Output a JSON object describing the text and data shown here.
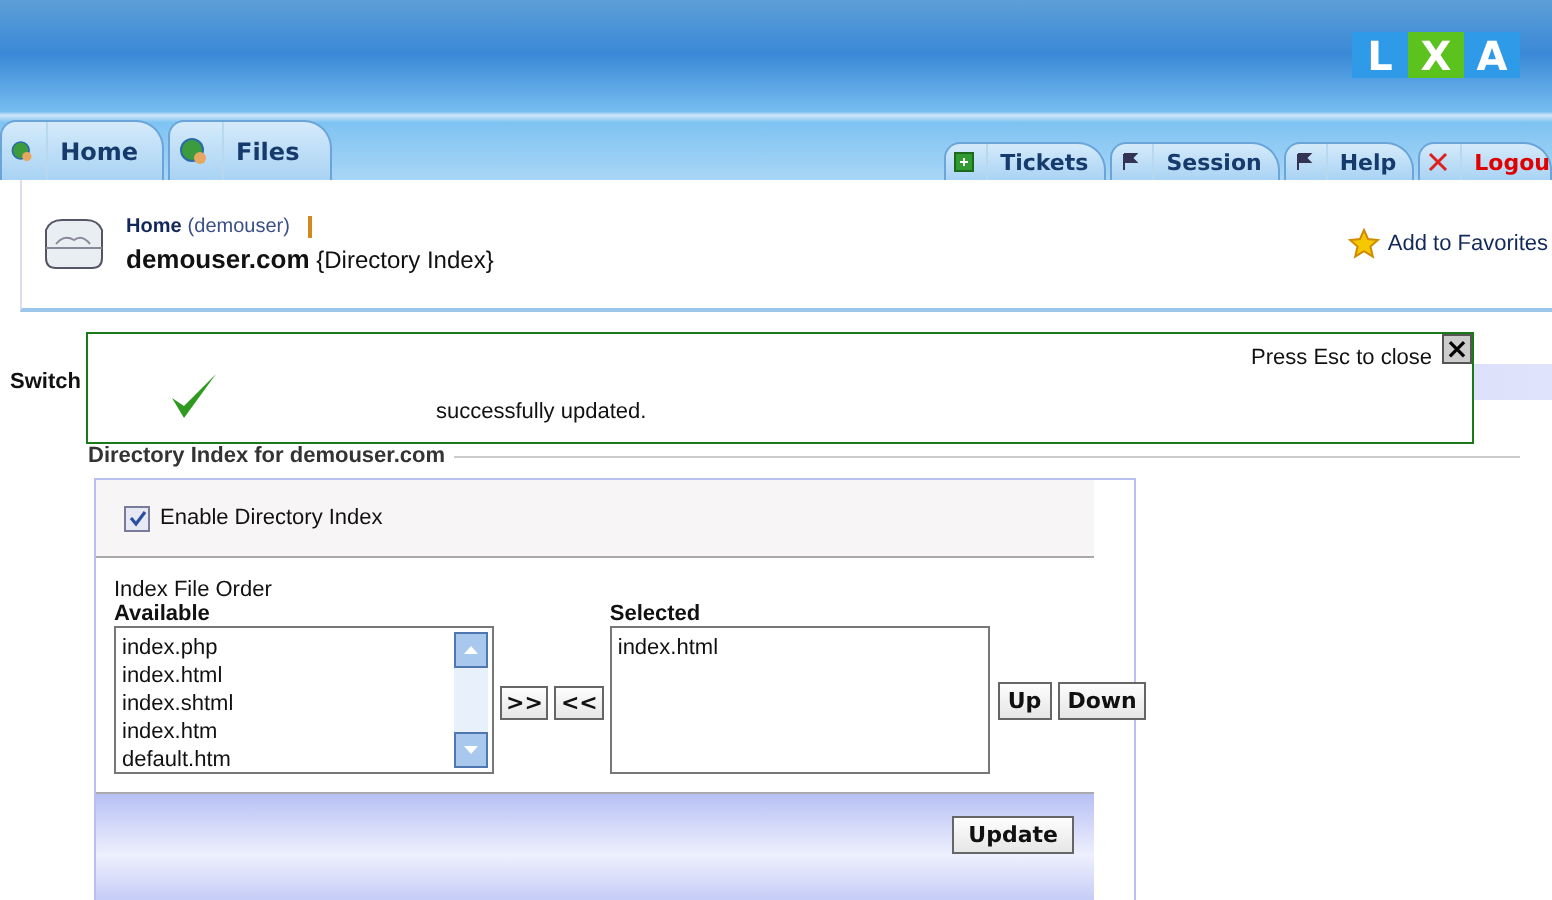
{
  "header": {
    "logo": [
      "L",
      "X",
      "A"
    ]
  },
  "tabs_left": [
    {
      "label": "Home",
      "kind": "globe"
    },
    {
      "label": "Files",
      "kind": "globe"
    }
  ],
  "tabs_right": [
    {
      "label": "Tickets",
      "kind": "tickets"
    },
    {
      "label": "Session",
      "kind": "flag"
    },
    {
      "label": "Help",
      "kind": "flag"
    },
    {
      "label": "Logou",
      "kind": "logout"
    }
  ],
  "breadcrumb": {
    "link": "Home",
    "user": "(demouser)",
    "title": "demouser.com",
    "subtitle": "{Directory Index}"
  },
  "favorites": "Add to Favorites",
  "switch_label": "Switch",
  "notice": {
    "message": "successfully updated.",
    "close_hint": "Press Esc to close",
    "close": "×"
  },
  "section": {
    "legend": "Directory Index for demouser.com",
    "enable": {
      "label": "Enable Directory Index",
      "checked": true
    },
    "order_label": "Index File Order",
    "available": {
      "label": "Available",
      "items": [
        "index.php",
        "index.html",
        "index.shtml",
        "index.htm",
        "default.htm"
      ]
    },
    "move_buttons": [
      ">>",
      "<<"
    ],
    "selected": {
      "label": "Selected",
      "items": [
        "index.html"
      ]
    },
    "order_buttons": [
      "Up",
      "Down"
    ],
    "submit": "Update"
  }
}
